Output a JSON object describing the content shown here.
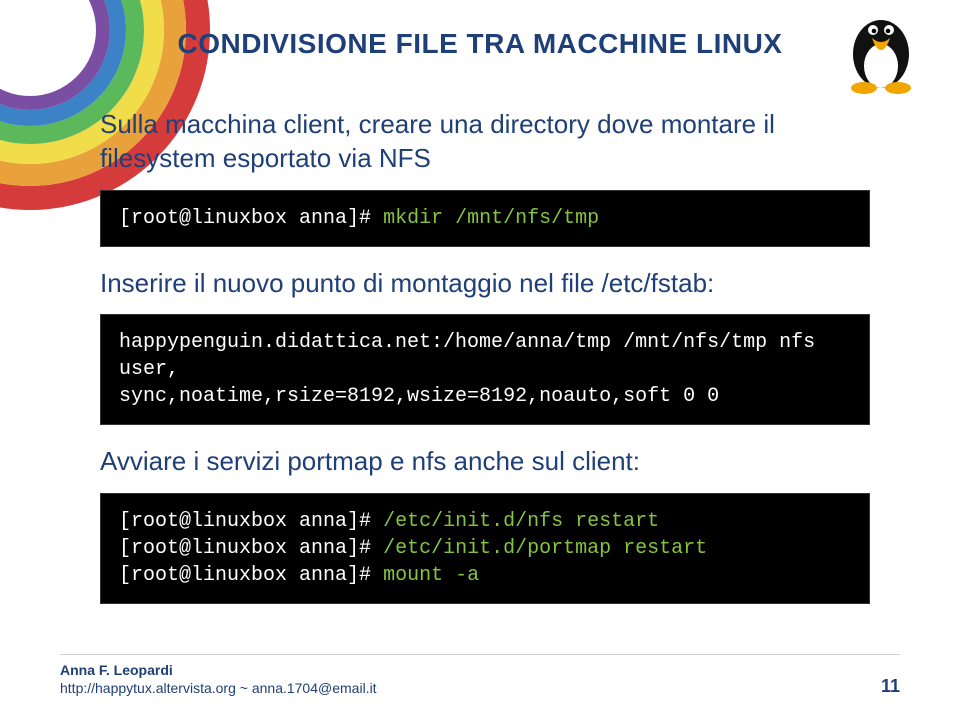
{
  "title": "CONDIVISIONE FILE TRA MACCHINE LINUX",
  "body": {
    "p1": "Sulla macchina client, creare una directory dove montare il filesystem esportato via NFS",
    "term1": {
      "prompt": "[root@linuxbox anna]#",
      "cmd": "mkdir /mnt/nfs/tmp"
    },
    "p2": "Inserire il nuovo punto di montaggio nel file /etc/fstab:",
    "term2": {
      "line1": "happypenguin.didattica.net:/home/anna/tmp /mnt/nfs/tmp nfs user,",
      "line2": "sync,noatime,rsize=8192,wsize=8192,noauto,soft 0 0"
    },
    "p3": "Avviare i servizi portmap e nfs anche sul client:",
    "term3": {
      "l1_prompt": "[root@linuxbox anna]#",
      "l1_cmd": "/etc/init.d/nfs restart",
      "l2_prompt": "[root@linuxbox anna]#",
      "l2_cmd": "/etc/init.d/portmap restart",
      "l3_prompt": "[root@linuxbox anna]#",
      "l3_cmd": "mount -a"
    }
  },
  "footer": {
    "author": "Anna F. Leopardi",
    "url": "http://happytux.altervista.org ~ anna.1704@email.it",
    "page": "11"
  },
  "icons": {
    "tux": "tux-mascot-icon"
  }
}
